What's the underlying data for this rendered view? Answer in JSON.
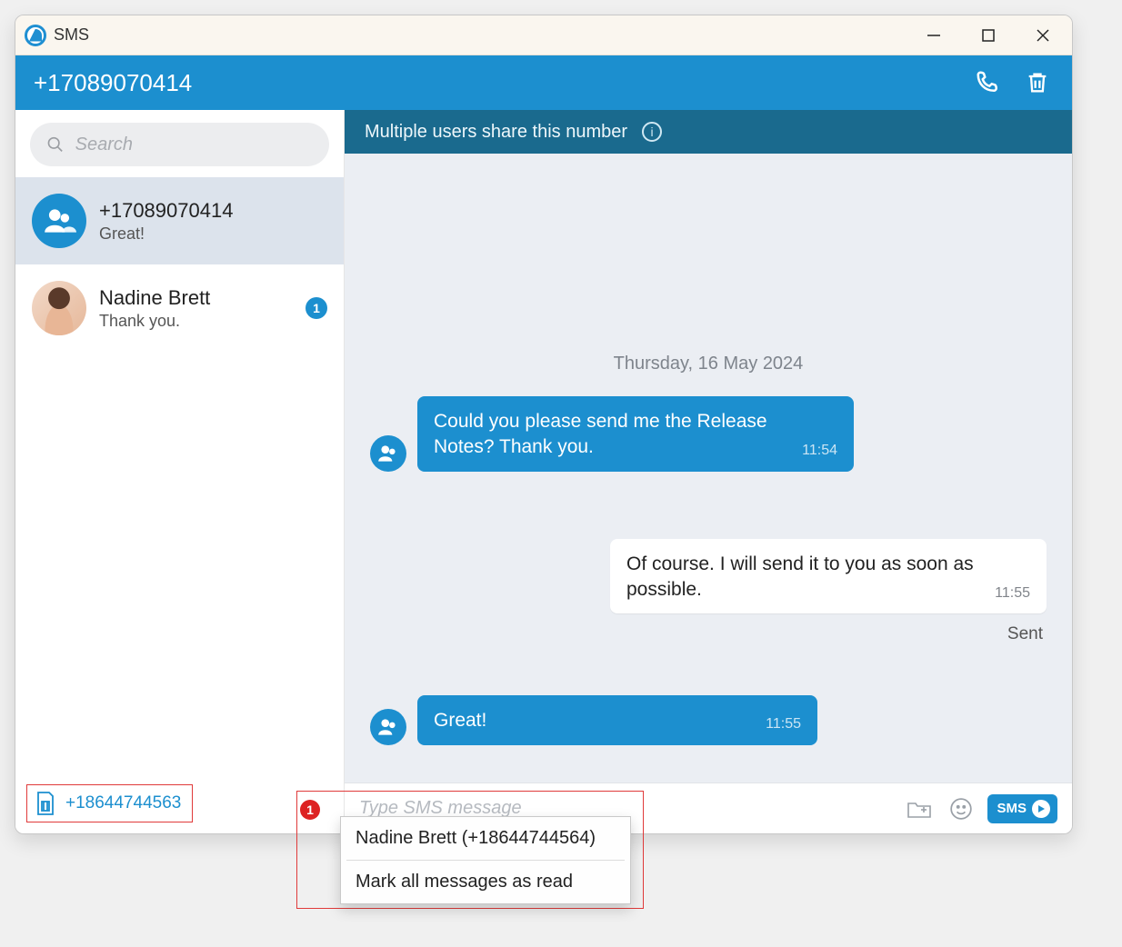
{
  "window": {
    "title": "SMS"
  },
  "header": {
    "phone": "+17089070414"
  },
  "search": {
    "placeholder": "Search"
  },
  "conversations": [
    {
      "name": "+17089070414",
      "preview": "Great!",
      "selected": true,
      "group": true,
      "unread": null
    },
    {
      "name": "Nadine Brett",
      "preview": "Thank you.",
      "selected": false,
      "group": false,
      "unread": "1"
    }
  ],
  "sim": {
    "number": "+18644744563"
  },
  "notice": {
    "text": "Multiple users share this number"
  },
  "chat": {
    "date_label": "Thursday, 16 May 2024",
    "messages": [
      {
        "side": "them",
        "text": "Could you please send me the Release Notes? Thank you.",
        "time": "11:54"
      },
      {
        "side": "me",
        "text": "Of course. I will send it to you as soon as possible.",
        "time": "11:55",
        "status": "Sent"
      },
      {
        "side": "them",
        "text": "Great!",
        "time": "11:55"
      }
    ]
  },
  "composer": {
    "placeholder": "Type SMS message",
    "send_label": "SMS"
  },
  "popup": {
    "badge": "1",
    "items": [
      "Nadine Brett (+18644744564)",
      "Mark all messages as read"
    ]
  }
}
